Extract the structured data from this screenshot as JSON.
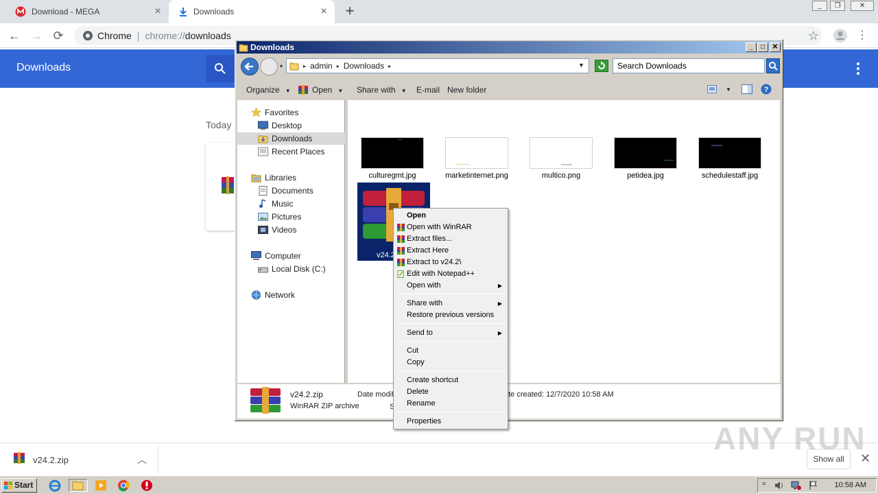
{
  "browser": {
    "tabs": [
      {
        "title": "Download - MEGA",
        "icon": "mega-icon"
      },
      {
        "title": "Downloads",
        "icon": "download-arrow-icon"
      }
    ],
    "omnibox": {
      "label": "Chrome",
      "scheme": "chrome://",
      "path": "downloads"
    }
  },
  "downloads_page": {
    "header_title": "Downloads",
    "section": "Today"
  },
  "shelf": {
    "file": "v24.2.zip",
    "show_all": "Show all"
  },
  "explorer": {
    "title": "Downloads",
    "breadcrumb": [
      "admin",
      "Downloads"
    ],
    "search_placeholder": "Search Downloads",
    "commands": {
      "organize": "Organize",
      "open": "Open",
      "share_with": "Share with",
      "email": "E-mail",
      "new_folder": "New folder"
    },
    "nav": {
      "favorites": "Favorites",
      "desktop": "Desktop",
      "downloads": "Downloads",
      "recent": "Recent Places",
      "libraries": "Libraries",
      "documents": "Documents",
      "music": "Music",
      "pictures": "Pictures",
      "videos": "Videos",
      "computer": "Computer",
      "local_disk": "Local Disk (C:)",
      "network": "Network"
    },
    "files": [
      {
        "name": "culturegmt.jpg",
        "bg": "#000000"
      },
      {
        "name": "marketinternet.png",
        "bg": "#ffffff"
      },
      {
        "name": "multico.png",
        "bg": "#ffffff"
      },
      {
        "name": "petidea.jpg",
        "bg": "#000000"
      },
      {
        "name": "schedulestaff.jpg",
        "bg": "#000000"
      }
    ],
    "selected_file_partial": "v24.2",
    "details": {
      "name": "v24.2.zip",
      "type": "WinRAR ZIP archive",
      "date_modified_partial": "Date modifi",
      "size_partial": "S",
      "date_created": "ate created:  12/7/2020 10:58 AM"
    }
  },
  "context_menu": {
    "open": "Open",
    "open_winrar": "Open with WinRAR",
    "extract_files": "Extract files...",
    "extract_here": "Extract Here",
    "extract_to": "Extract to v24.2\\",
    "edit_notepad": "Edit with Notepad++",
    "open_with": "Open with",
    "share_with": "Share with",
    "restore": "Restore previous versions",
    "send_to": "Send to",
    "cut": "Cut",
    "copy": "Copy",
    "create_shortcut": "Create shortcut",
    "delete": "Delete",
    "rename": "Rename",
    "properties": "Properties"
  },
  "taskbar": {
    "start": "Start",
    "clock": "10:58 AM"
  },
  "watermark": "ANY RUN",
  "colors": {
    "chrome_blue": "#3367d6",
    "selection": "#0a246a",
    "taskbar": "#d4d0c8"
  }
}
